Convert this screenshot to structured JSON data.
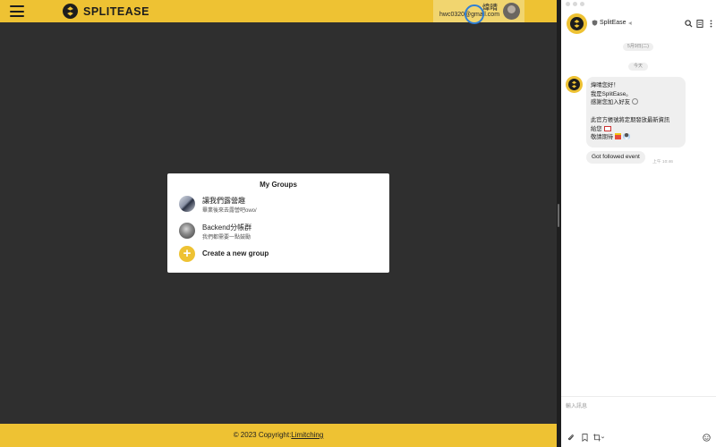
{
  "brand": {
    "name": "SPLITEASE",
    "color": "#eec233"
  },
  "user": {
    "name": "煒晴",
    "email": "hwc0320@gmail.com"
  },
  "groups_card": {
    "title": "My Groups",
    "groups": [
      {
        "name": "讓我們露營趣",
        "description": "畢業後來去露營吧owo/"
      },
      {
        "name": "Backend分帳群",
        "description": "我們都需要一點鼓勵"
      }
    ],
    "create_label": "Create a new group"
  },
  "footer": {
    "prefix": "© 2023 Copyright:",
    "link": "Limitching"
  },
  "chat": {
    "title": "SplitEase",
    "date_label": "5月9日(二)",
    "today_label": "今天",
    "messages": {
      "greeting_lines": [
        "煒晴您好！",
        "我是SplitEase。",
        "感謝您加入好友",
        "",
        "此官方帳號將定期發放最新資訊",
        "給您",
        "敬請期待"
      ],
      "event_text": "Got followed event",
      "time": "上午 10:46"
    },
    "input_placeholder": "輸入訊息"
  },
  "icons": {
    "menu": "hamburger-icon",
    "brand": "splitease-logo-icon",
    "add": "plus-icon",
    "search": "search-icon",
    "notes": "notes-icon",
    "more": "more-icon",
    "attach": "paperclip-icon",
    "bookmark": "bookmark-icon",
    "crop": "crop-icon",
    "emoji": "emoji-icon"
  }
}
